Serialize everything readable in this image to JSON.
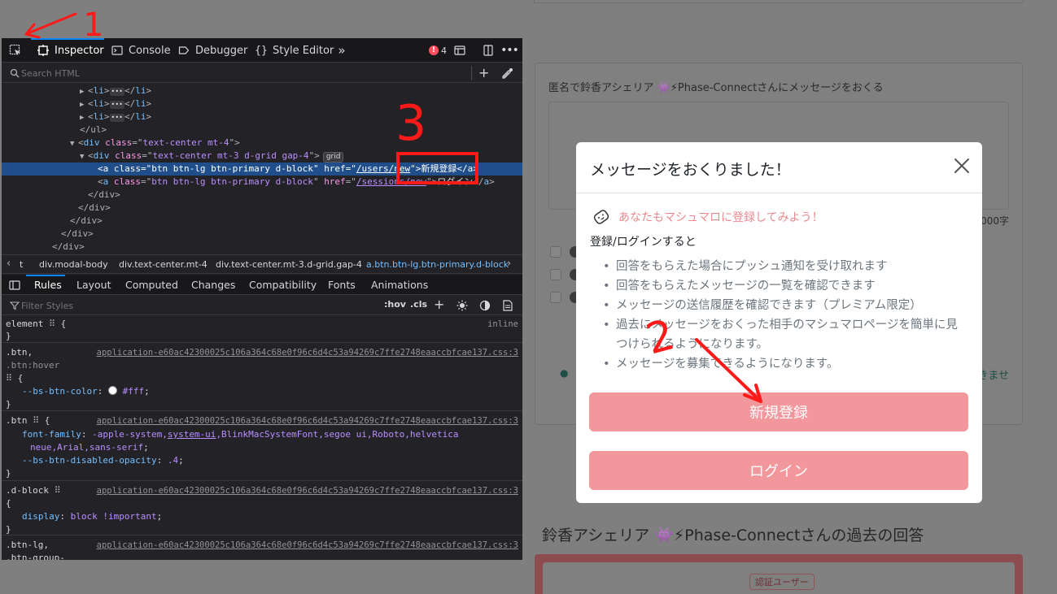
{
  "background_page": {
    "message_form_title": "匿名で鈴香アシェリア 👾⚡Phase-Connectさんにメッセージをおくる",
    "char_count": "000字",
    "send_link": "きませ",
    "past_answers_title": "鈴香アシェリア 👾⚡Phase-Connectさんの過去の回答",
    "verified_badge": "認証ユーザー"
  },
  "modal": {
    "title": "メッセージをおくりました！",
    "close_icon": "close-icon",
    "promo_icon": "marshmallow-icon",
    "promo_text": "あなたもマシュマロに登録してみよう！",
    "subhead": "登録/ログインすると",
    "benefits": [
      "回答をもらえた場合にプッシュ通知を受け取れます",
      "回答をもらえたメッセージの一覧を確認できます",
      "メッセージの送信履歴を確認できます（プレミアム限定）",
      "過去にメッセージをおくった相手のマシュマロページを簡単に見つけられるようになります。",
      "メッセージを募集できるようになります。"
    ],
    "signup_label": "新規登録",
    "login_label": "ログイン",
    "button_color": "#f2979c"
  },
  "devtools": {
    "toolbar": {
      "tabs": [
        "Inspector",
        "Console",
        "Debugger",
        "Style Editor"
      ],
      "error_count": "4"
    },
    "search_placeholder": "Search HTML",
    "dom": {
      "li_tag": "li",
      "ul_close": "</ul>",
      "div1_tag": "div",
      "div1_class_attr": "class",
      "div1_class": "text-center mt-4",
      "div2_class": "text-center mt-3 d-grid gap-4",
      "grid_badge": "grid",
      "a_tag": "a",
      "btn_class": "btn btn-lg btn-primary d-block",
      "href_attr": "href",
      "href1": "/users/new",
      "text1": "新規登録",
      "href2": "/sessions/new",
      "text2": "ログイン",
      "div_close": "</div>"
    },
    "breadcrumbs": [
      "t",
      "div.modal-body",
      "div.text-center.mt-4",
      "div.text-center.mt-3.d-grid.gap-4",
      "a.btn.btn-lg.btn-primary.d-block"
    ],
    "side_tabs": [
      "Rules",
      "Layout",
      "Computed",
      "Changes",
      "Compatibility",
      "Fonts",
      "Animations"
    ],
    "filter_placeholder": "Filter Styles",
    "filter_hov": ":hov",
    "filter_cls": ".cls",
    "rules": {
      "element_selector": "element",
      "element_source": "inline",
      "css_source": "application-e60ac42300025c106a364c68e0f96c6d4c53a94269c7ffe2748eaaccbfcae137.css:3",
      "btn_hover_selector_1": ".btn,",
      "btn_hover_selector_2": ".btn:hover",
      "bs_btn_color_prop": "--bs-btn-color",
      "bs_btn_color_val": "#fff",
      "btn_selector": ".btn",
      "font_family_prop": "font-family",
      "font_family_val_1": "-apple-system,",
      "font_family_sys": "system-ui",
      "font_family_val_2": ",BlinkMacSystemFont,segoe ui,Roboto,helvetica",
      "font_family_val_3": "neue,Arial,sans-serif",
      "disabled_opacity_prop": "--bs-btn-disabled-opacity",
      "disabled_opacity_val": ".4",
      "dblock_selector": ".d-block",
      "display_prop": "display",
      "display_val": "block !important",
      "btnlg_selector_1": ".btn-lg,",
      "btnlg_selector_2": ".btn-group-"
    }
  },
  "annotations": {
    "num_1": "1",
    "num_2": "2",
    "num_3": "3",
    "color": "#ff1a1a"
  }
}
